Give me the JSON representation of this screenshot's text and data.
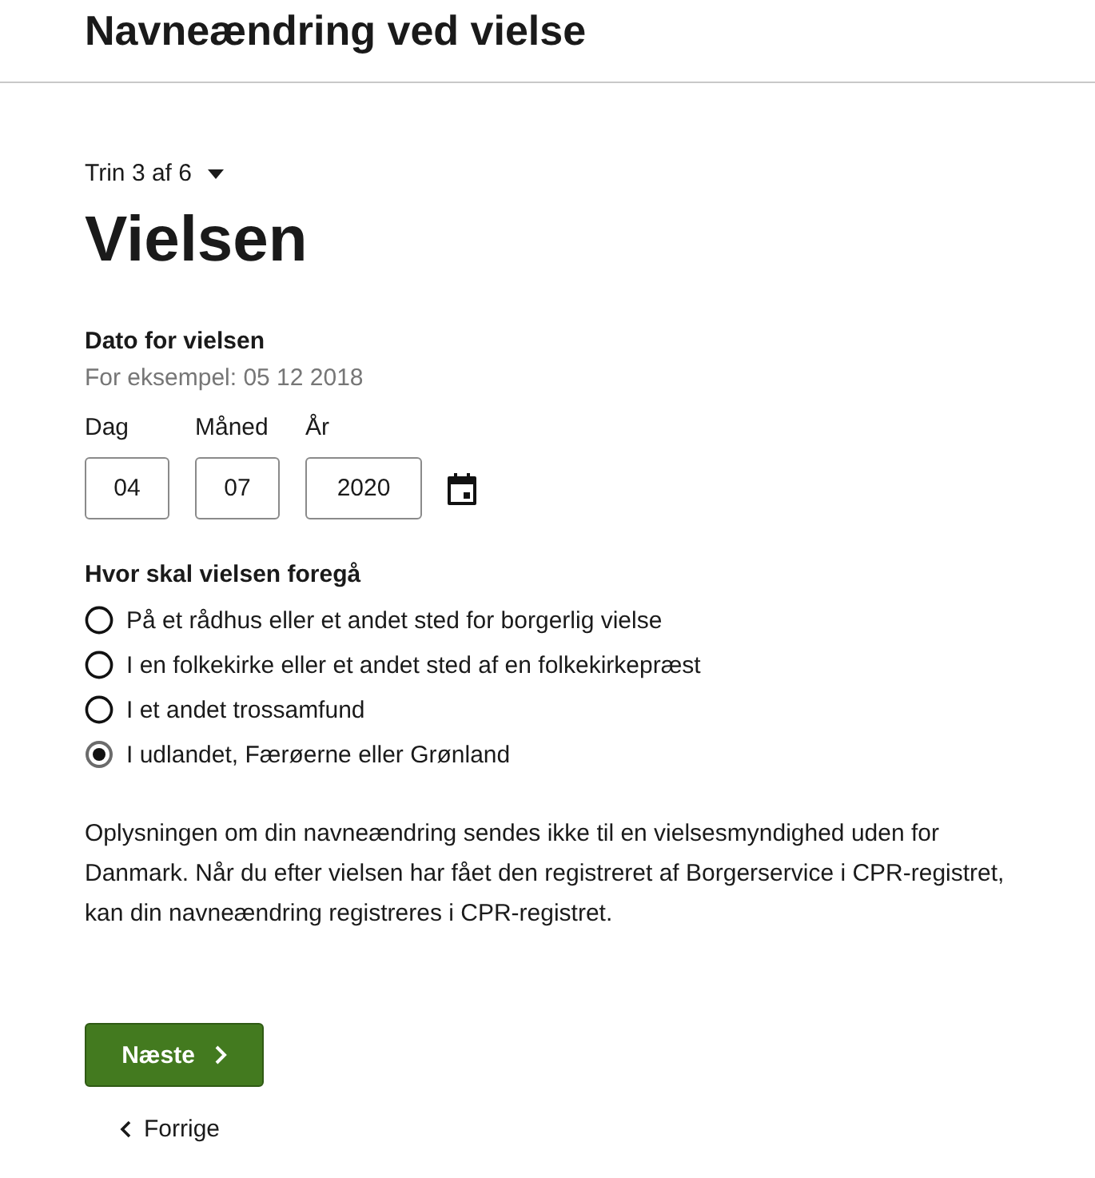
{
  "header": {
    "title": "Navneændring ved vielse"
  },
  "step": {
    "label": "Trin 3 af 6"
  },
  "heading": "Vielsen",
  "date": {
    "label": "Dato for vielsen",
    "hint": "For eksempel: 05 12 2018",
    "fields": [
      {
        "label": "Dag",
        "value": "04"
      },
      {
        "label": "Måned",
        "value": "07"
      },
      {
        "label": "År",
        "value": "2020"
      }
    ]
  },
  "place": {
    "label": "Hvor skal vielsen foregå",
    "options": [
      {
        "label": "På et rådhus eller et andet sted for borgerlig vielse",
        "selected": false
      },
      {
        "label": "I en folkekirke eller et andet sted af en folkekirkepræst",
        "selected": false
      },
      {
        "label": "I et andet trossamfund",
        "selected": false
      },
      {
        "label": "I udlandet, Færøerne eller Grønland",
        "selected": true
      }
    ]
  },
  "info": "Oplysningen om din navneændring sendes ikke til en vielsesmyndighed uden for Danmark. Når du efter vielsen har fået den registreret af Borgerservice i CPR-registret, kan din navneændring registreres i CPR-registret.",
  "next_button": "Næste",
  "back_link": "Forrige"
}
